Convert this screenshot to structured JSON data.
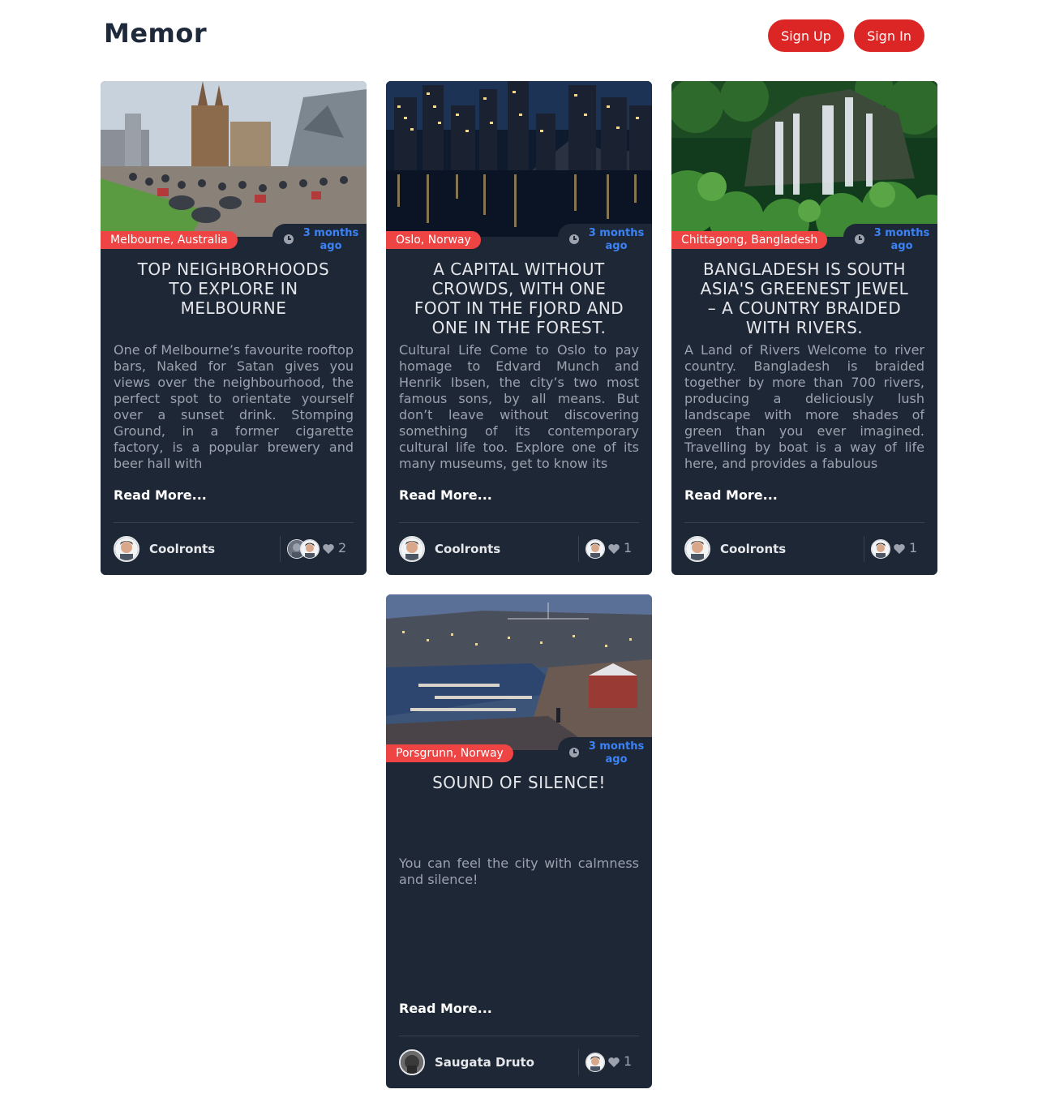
{
  "header": {
    "logo": "Memor",
    "signup_label": "Sign Up",
    "signin_label": "Sign In",
    "accent_color": "#dc2626"
  },
  "posts": [
    {
      "location": "Melbourne, Australia",
      "time": "3 months ago",
      "title": "TOP NEIGHBORHOODS TO EXPLORE IN MELBOURNE",
      "excerpt": "One of Melbourne’s favourite rooftop bars, Naked for Satan gives you views over the neighbourhood, the perfect spot to orientate yourself over a sunset drink. Stomping Ground, in a former cigarette factory, is a popular brewery and beer hall with",
      "read_more": "Read More...",
      "author": "Coolronts",
      "likes": "2",
      "image": "city-square-crowd"
    },
    {
      "location": "Oslo, Norway",
      "time": "3 months ago",
      "title": "A CAPITAL WITHOUT CROWDS, WITH ONE FOOT IN THE FJORD AND ONE IN THE FOREST.",
      "excerpt": "Cultural Life Come to Oslo to pay homage to Edvard Munch and Henrik Ibsen, the city’s two most famous sons, by all means. But don’t leave without discovering something of its contemporary cultural life too. Explore one of its many museums, get to know its",
      "read_more": "Read More...",
      "author": "Coolronts",
      "likes": "1",
      "image": "night-skyline-reflection"
    },
    {
      "location": "Chittagong, Bangladesh",
      "time": "3 months ago",
      "title": "BANGLADESH IS SOUTH ASIA'S GREENEST JEWEL – A COUNTRY BRAIDED WITH RIVERS.",
      "excerpt": "A Land of Rivers Welcome to river country. Bangladesh is braided together by more than 700 rivers, producing a deliciously lush landscape with more shades of green than you ever imagined. Travelling by boat is a way of life here, and provides a fabulous",
      "read_more": "Read More...",
      "author": "Coolronts",
      "likes": "1",
      "image": "jungle-waterfall"
    },
    {
      "location": "Porsgrunn, Norway",
      "time": "3 months ago",
      "title": "SOUND OF SILENCE!",
      "excerpt": "You can feel the city with calmness and silence!",
      "read_more": "Read More...",
      "author": "Saugata Druto",
      "likes": "1",
      "image": "harbor-town-dusk"
    }
  ]
}
